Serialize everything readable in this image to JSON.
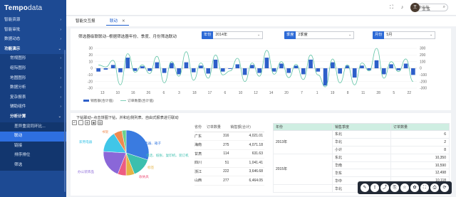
{
  "app": {
    "logo_main": "Tempo",
    "logo_sub": "data"
  },
  "sidebar": {
    "items": [
      {
        "label": "智能资源",
        "level": 0,
        "expandable": true
      },
      {
        "label": "智能审批",
        "level": 0,
        "expandable": true
      },
      {
        "label": "数据动态",
        "level": 0,
        "expandable": true
      },
      {
        "label": "功能演示",
        "level": 0,
        "expandable": true,
        "open": true
      },
      {
        "label": "常规图形",
        "level": 1,
        "expandable": true
      },
      {
        "label": "组际图形",
        "level": 1,
        "expandable": true
      },
      {
        "label": "地图图形",
        "level": 1,
        "expandable": true
      },
      {
        "label": "数据分析",
        "level": 1,
        "expandable": true
      },
      {
        "label": "复杂报表",
        "level": 1,
        "expandable": true
      },
      {
        "label": "辅助组件",
        "level": 1,
        "expandable": true
      },
      {
        "label": "分析计算",
        "level": 1,
        "expandable": true,
        "open": true
      },
      {
        "label": "差异重设同环比...",
        "level": 2
      },
      {
        "label": "联动",
        "level": 2,
        "active": true
      },
      {
        "label": "链接",
        "level": 2
      },
      {
        "label": "排序排位",
        "level": 2
      },
      {
        "label": "筛选",
        "level": 2
      }
    ]
  },
  "header": {
    "search_placeholder": "搜索名称",
    "username": "王玉",
    "avatar_text": "王"
  },
  "tabs": [
    {
      "label": "智能交互报",
      "active": false
    },
    {
      "label": "联动",
      "active": true
    }
  ],
  "filters": {
    "label": "筛选器级联联动--根据筛选器年份、季度、月份筛选联动",
    "year": {
      "tag": "年份",
      "value": "2014年"
    },
    "quarter": {
      "tag": "季度",
      "value": "2季度"
    },
    "month": {
      "tag": "月份",
      "value": "5月"
    }
  },
  "chart_data": {
    "type": "bar",
    "x_categories": [
      "13",
      "10",
      "10",
      "21",
      "10",
      "29",
      "11",
      "6",
      "13",
      "12",
      "18",
      "30",
      "13",
      "11",
      "14",
      "19",
      "11",
      "17",
      "20",
      "2",
      "10",
      "15",
      "13",
      "4",
      "12",
      "11",
      "10",
      "13",
      "16",
      "12",
      "14",
      "18",
      "1",
      "9",
      "11",
      "16",
      "12",
      "19",
      "20",
      "3",
      "5",
      "14",
      "17",
      "22"
    ],
    "x_labels_shown": [
      "13",
      "10",
      "16",
      "26",
      "6",
      "3",
      "18",
      "17",
      "6",
      "10",
      "12",
      "14",
      "20",
      "7",
      "1",
      "19",
      "8",
      "11",
      "28",
      "5",
      "22"
    ],
    "series": [
      {
        "name": "销售额(合计值)",
        "type": "bar",
        "color": "#2d5fc9",
        "values": [
          -5,
          -2,
          5,
          -6,
          16,
          -4,
          3,
          -4,
          9,
          -7,
          8,
          -9,
          9,
          -6,
          4,
          -8,
          13,
          -5,
          -1,
          6,
          -10,
          5,
          -7,
          16,
          -5,
          7,
          -7,
          4,
          -9,
          13,
          -5,
          -26,
          9,
          -8,
          4,
          -14,
          4,
          -3,
          12,
          -9,
          6,
          -3,
          7,
          -10
        ]
      },
      {
        "name": "订单数量(合计值)",
        "type": "line",
        "color": "#5fc3a5",
        "values": [
          5,
          2,
          12,
          -25,
          22,
          -6,
          5,
          -8,
          18,
          -22,
          10,
          -12,
          25,
          -18,
          8,
          -15,
          20,
          -10,
          -4,
          15,
          -20,
          8,
          -12,
          27,
          -9,
          10,
          -14,
          6,
          -17,
          20,
          -10,
          -28,
          14,
          -22,
          5,
          -25,
          8,
          -4,
          30,
          -15,
          10,
          -5,
          14,
          -20
        ]
      }
    ],
    "left_axis": {
      "ticks": [
        30,
        20,
        10,
        0,
        -10,
        -20,
        -30
      ]
    },
    "right_axis": {
      "ticks": [
        300,
        200,
        100,
        0,
        -100,
        -200,
        -300
      ]
    },
    "legend": [
      "销售额(合计值)",
      "订单数量(合计值)"
    ]
  },
  "bottom": {
    "title": "下钻联动--点击饼图下钻，并和右侧列表、自由式报表进行联动",
    "pie": {
      "slices": [
        {
          "label": "电器、箱子",
          "value": 30,
          "color": "#3a7be0"
        },
        {
          "label": "电话、纸张、复印机、装订机",
          "value": 14,
          "color": "#3cbfae"
        },
        {
          "label": "标签",
          "value": 6,
          "color": "#e5b345"
        },
        {
          "label": "收纳具",
          "value": 6,
          "color": "#ed5c82"
        },
        {
          "label": "办公装饰品",
          "value": 20,
          "color": "#8a67d8"
        },
        {
          "label": "家用电器",
          "value": 15,
          "color": "#40c6e8"
        },
        {
          "label": "书架",
          "value": 6,
          "color": "#f08a50"
        },
        {
          "label": "",
          "value": 3,
          "color": "#6ad18c"
        }
      ]
    },
    "table1": {
      "headers": [
        "省份",
        "订单数量",
        "销售额(合计)"
      ],
      "rows": [
        [
          "广东",
          "316",
          "4,021.01"
        ],
        [
          "海南",
          "275",
          "4,071.18"
        ],
        [
          "甘肃",
          "114",
          "631.63"
        ],
        [
          "四川",
          "51",
          "1,041.41"
        ],
        [
          "浙江",
          "222",
          "3,646.68"
        ],
        [
          "山西",
          "277",
          "6,464.05"
        ]
      ]
    },
    "table2": {
      "headers": [
        "年份",
        "销售季度",
        "订单数量"
      ],
      "groups": [
        {
          "year": "2013年",
          "rows": [
            [
              "东北",
              "6"
            ],
            [
              "华北",
              "2"
            ],
            [
              "小计",
              "8"
            ]
          ]
        },
        {
          "year": "2015年",
          "rows": [
            [
              "东北",
              "10,350"
            ],
            [
              "华南",
              "10,590"
            ],
            [
              "华东",
              "12,498"
            ],
            [
              "华中",
              "10,118"
            ]
          ]
        }
      ],
      "last_row_label": "华北"
    }
  },
  "floatbar": {
    "icons": [
      "edit-icon",
      "export-icon",
      "share-icon",
      "link-icon",
      "star-icon",
      "settings-icon",
      "fullscreen-icon",
      "print-icon",
      "refresh-icon"
    ],
    "glyphs": [
      "✎",
      "⇪",
      "⤴",
      "⎘",
      "☆",
      "✿",
      "⛶",
      "⎙",
      "⟳"
    ]
  }
}
